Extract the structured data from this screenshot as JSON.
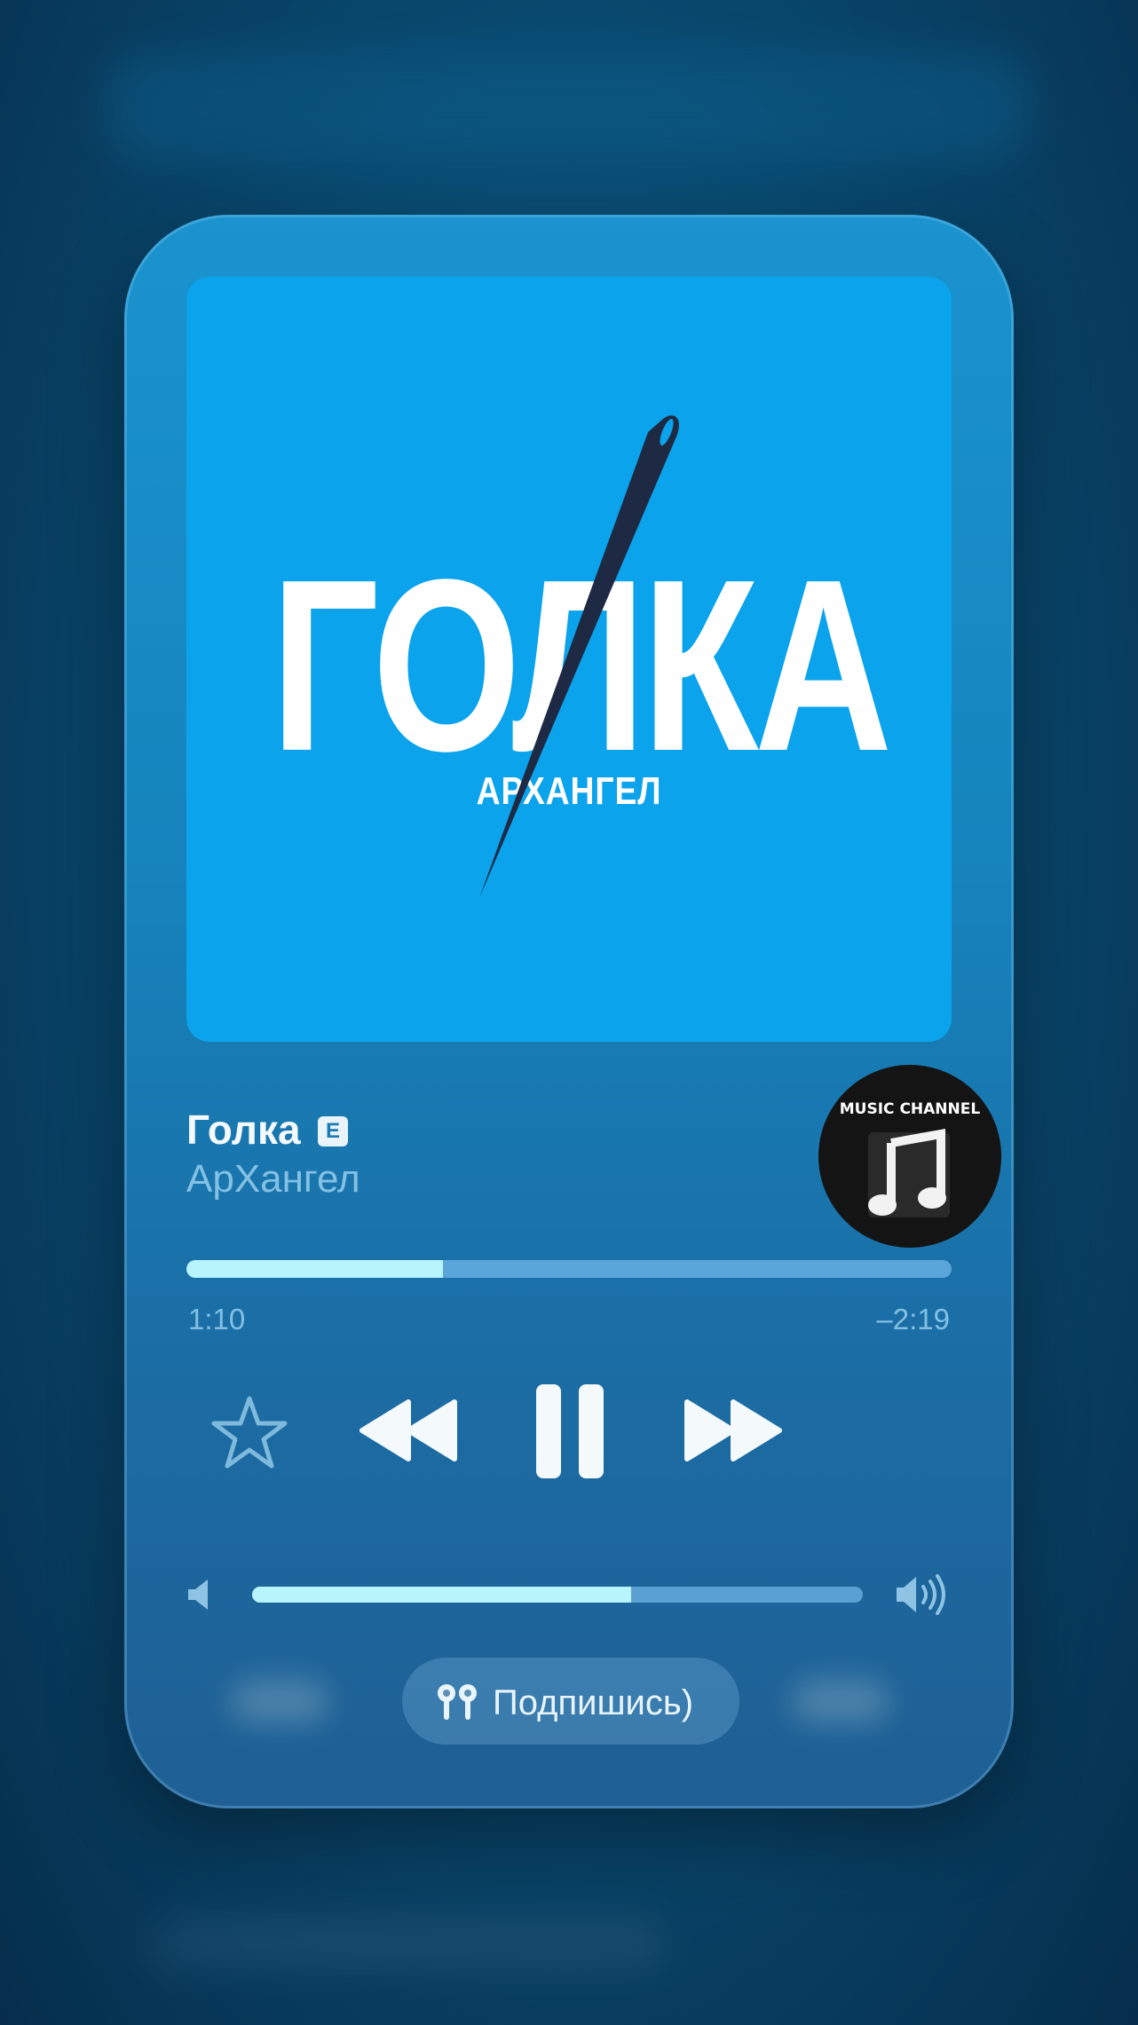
{
  "artwork": {
    "title_text": "ГОЛКА",
    "artist_text": "АРХАНГЕЛ",
    "background_color": "#0aa3ec"
  },
  "track": {
    "title": "Голка",
    "explicit_badge": "E",
    "artist": "АрХангел"
  },
  "channel_avatar": {
    "label": "MUSIC CHANNEL",
    "icon": "music-note-icon"
  },
  "progress": {
    "elapsed": "1:10",
    "remaining": "‒2:19",
    "fraction": 0.335
  },
  "controls": {
    "favorite_icon": "star-icon",
    "previous_icon": "rewind-icon",
    "play_pause_icon": "pause-icon",
    "next_icon": "fast-forward-icon"
  },
  "volume": {
    "low_icon": "speaker-low-icon",
    "high_icon": "speaker-high-icon",
    "fraction": 0.62
  },
  "output": {
    "device_icon": "airpods-icon",
    "label": "Подпишись)"
  },
  "colors": {
    "accent": "#b8f4fb",
    "card": "#1684bd",
    "secondary_text": "#83c0e3"
  }
}
